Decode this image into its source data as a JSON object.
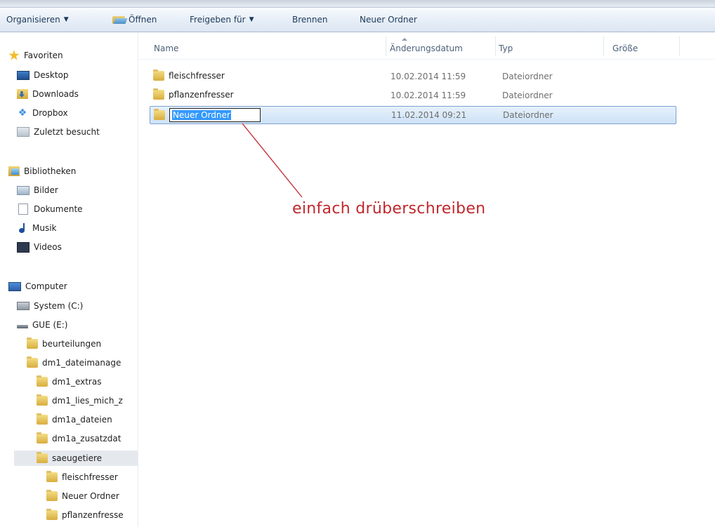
{
  "toolbar": {
    "organize": "Organisieren",
    "open": "Öffnen",
    "share": "Freigeben für",
    "burn": "Brennen",
    "new_folder": "Neuer Ordner"
  },
  "nav": {
    "favorites": "Favoriten",
    "desktop": "Desktop",
    "downloads": "Downloads",
    "dropbox": "Dropbox",
    "recent": "Zuletzt besucht",
    "libraries": "Bibliotheken",
    "pictures": "Bilder",
    "documents": "Dokumente",
    "music": "Musik",
    "videos": "Videos",
    "computer": "Computer",
    "system": "System (C:)",
    "drive": "GUE (E:)",
    "tree": [
      {
        "label": "beurteilungen"
      },
      {
        "label": "dm1_dateimanage"
      },
      {
        "label": "dm1_extras"
      },
      {
        "label": "dm1_lies_mich_z"
      },
      {
        "label": "dm1a_dateien"
      },
      {
        "label": "dm1a_zusatzdat"
      },
      {
        "label": "saeugetiere"
      },
      {
        "label": "fleischfresser"
      },
      {
        "label": "Neuer Ordner"
      },
      {
        "label": "pflanzenfresse"
      }
    ]
  },
  "columns": {
    "name": "Name",
    "date": "Änderungsdatum",
    "type": "Typ",
    "size": "Größe"
  },
  "files": [
    {
      "name": "fleischfresser",
      "date": "10.02.2014 11:59",
      "type": "Dateiordner"
    },
    {
      "name": "pflanzenfresser",
      "date": "10.02.2014 11:59",
      "type": "Dateiordner"
    },
    {
      "name": "Neuer Ordner",
      "date": "11.02.2014 09:21",
      "type": "Dateiordner"
    }
  ],
  "annotation": "einfach drüberschreiben",
  "colors": {
    "annotation": "#c0282d",
    "selection": "#3399ff",
    "toolbar_text": "#1e395b"
  }
}
